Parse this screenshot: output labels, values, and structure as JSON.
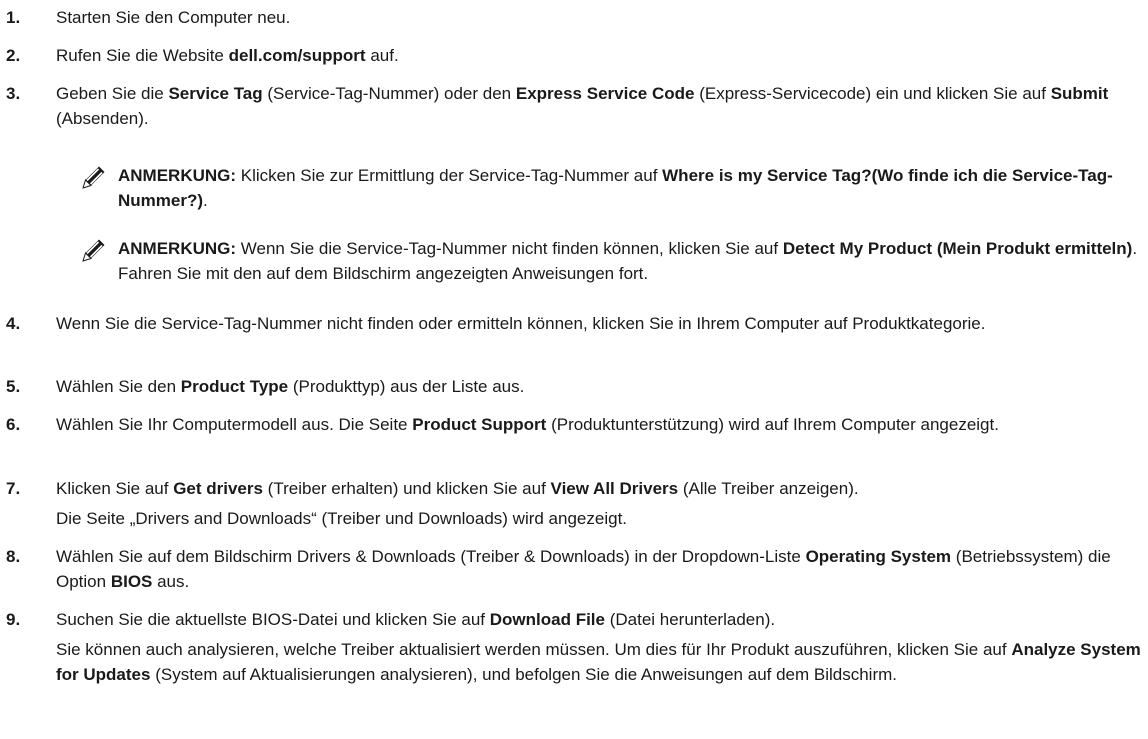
{
  "steps": [
    {
      "num": "1.",
      "parts": [
        {
          "t": "Starten Sie den Computer neu."
        }
      ]
    },
    {
      "num": "2.",
      "parts": [
        {
          "t": "Rufen Sie die Website "
        },
        {
          "b": "dell.com/support"
        },
        {
          "t": " auf."
        }
      ]
    },
    {
      "num": "3.",
      "parts": [
        {
          "t": "Geben Sie die "
        },
        {
          "b": "Service Tag"
        },
        {
          "t": " (Service-Tag-Nummer) oder den "
        },
        {
          "b": "Express Service Code"
        },
        {
          "t": " (Express-Servicecode) ein und klicken Sie auf "
        },
        {
          "b": "Submit"
        },
        {
          "t": " (Absenden)."
        }
      ]
    },
    {
      "num": "4.",
      "parts": [
        {
          "t": "Wenn Sie die Service-Tag-Nummer nicht finden oder ermitteln können, klicken Sie in Ihrem Computer auf Produktkategorie."
        }
      ]
    },
    {
      "num": "5.",
      "parts": [
        {
          "t": "Wählen Sie den "
        },
        {
          "b": "Product Type"
        },
        {
          "t": " (Produkttyp) aus der Liste aus."
        }
      ]
    },
    {
      "num": "6.",
      "parts": [
        {
          "t": "Wählen Sie Ihr Computermodell aus. Die Seite "
        },
        {
          "b": "Product Support"
        },
        {
          "t": " (Produktunterstützung) wird auf Ihrem Computer angezeigt."
        }
      ]
    },
    {
      "num": "7.",
      "parts": [
        {
          "t": "Klicken Sie auf "
        },
        {
          "b": "Get drivers"
        },
        {
          "t": " (Treiber erhalten) und klicken Sie auf "
        },
        {
          "b": "View All Drivers"
        },
        {
          "t": " (Alle Treiber anzeigen)."
        }
      ]
    },
    {
      "num": "8.",
      "parts": [
        {
          "t": "Wählen Sie auf dem Bildschirm Drivers & Downloads (Treiber & Downloads) in der Dropdown-Liste "
        },
        {
          "b": "Operating System"
        },
        {
          "t": " (Betriebssystem) die Option "
        },
        {
          "b": "BIOS"
        },
        {
          "t": " aus."
        }
      ]
    },
    {
      "num": "9.",
      "parts": [
        {
          "t": "Suchen Sie die aktuellste BIOS-Datei und klicken Sie auf "
        },
        {
          "b": "Download File"
        },
        {
          "t": " (Datei herunterladen)."
        }
      ]
    }
  ],
  "notes": [
    {
      "parts": [
        {
          "b": "ANMERKUNG:"
        },
        {
          "t": " Klicken Sie zur Ermittlung der Service-Tag-Nummer auf "
        },
        {
          "b": "Where is my Service Tag?(Wo finde ich die Service-Tag-Nummer?)"
        },
        {
          "t": "."
        }
      ]
    },
    {
      "parts": [
        {
          "b": "ANMERKUNG:"
        },
        {
          "t": " Wenn Sie die Service-Tag-Nummer nicht finden können, klicken Sie auf "
        },
        {
          "b": "Detect My Product (Mein Produkt ermitteln)"
        },
        {
          "t": ". Fahren Sie mit den auf dem Bildschirm angezeigten Anweisungen fort."
        }
      ]
    }
  ],
  "step7_followup": "Die Seite „Drivers and Downloads“ (Treiber und Downloads) wird angezeigt.",
  "step9_followup": [
    {
      "t": "Sie können auch analysieren, welche Treiber aktualisiert werden müssen. Um dies für Ihr Produkt auszuführen, klicken Sie auf "
    },
    {
      "b": "Analyze System for Updates"
    },
    {
      "t": " (System auf Aktualisierungen analysieren), und befolgen Sie die Anweisungen auf dem Bildschirm."
    }
  ],
  "icons": {
    "note": "pencil-note-icon"
  },
  "colors": {
    "text": "#1a1a1a",
    "icon": "#1a1a1a"
  }
}
